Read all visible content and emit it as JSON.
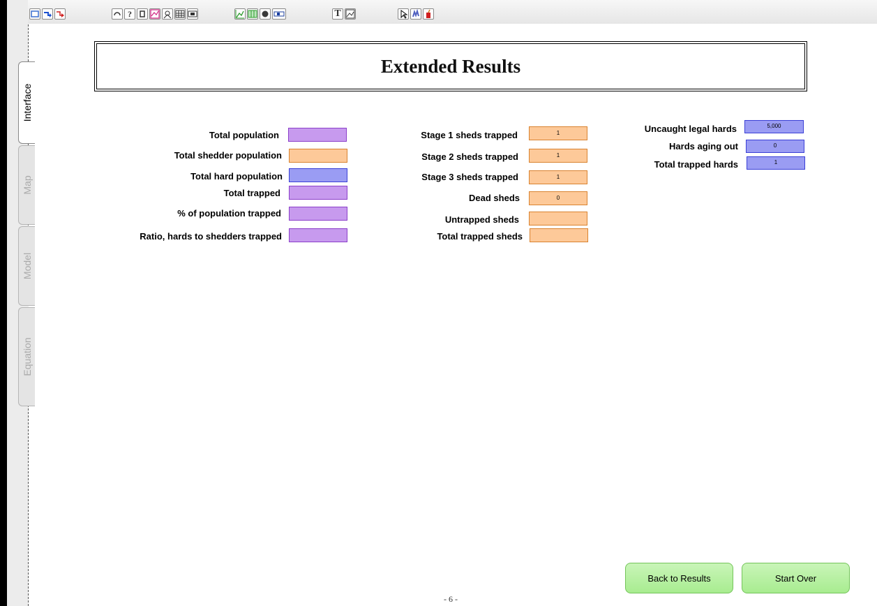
{
  "tabs": [
    {
      "label": "Interface",
      "active": true
    },
    {
      "label": "Map",
      "active": false
    },
    {
      "label": "Model",
      "active": false
    },
    {
      "label": "Equation",
      "active": false
    }
  ],
  "toolbar": {
    "icons": [
      "layer-icon",
      "flow-arrow-icon",
      "connector-arrow-icon",
      "loop-icon",
      "help-icon",
      "button-icon",
      "graph-icon",
      "sector-icon",
      "table-icon",
      "numeric-display-icon",
      "graph-pad-icon",
      "table-pad-icon",
      "knob-icon",
      "slider-icon",
      "text-icon",
      "image-icon",
      "pointer-icon",
      "hand-icon",
      "dynamite-icon"
    ],
    "help_glyph": "?",
    "text_glyph": "T"
  },
  "header": {
    "title": "Extended Results"
  },
  "left_column": {
    "total_population": {
      "label": "Total population",
      "value": ""
    },
    "total_shedder_population": {
      "label": "Total shedder population",
      "value": ""
    },
    "total_hard_population": {
      "label": "Total hard population",
      "value": ""
    },
    "total_trapped": {
      "label": "Total trapped",
      "value": ""
    },
    "percent_trapped": {
      "label": "% of population trapped",
      "value": ""
    },
    "ratio_trapped": {
      "label": "Ratio, hards to shedders trapped",
      "value": ""
    }
  },
  "middle_column": {
    "stage1": {
      "label": "Stage 1 sheds trapped",
      "value": "1"
    },
    "stage2": {
      "label": "Stage 2 sheds trapped",
      "value": "1"
    },
    "stage3": {
      "label": "Stage 3 sheds trapped",
      "value": "1"
    },
    "dead": {
      "label": "Dead sheds",
      "value": "0"
    },
    "untrapped": {
      "label": "Untrapped sheds",
      "value": ""
    },
    "total_trapped_sheds": {
      "label": "Total trapped sheds",
      "value": ""
    }
  },
  "right_column": {
    "uncaught_legal_hards": {
      "label": "Uncaught legal hards",
      "value": "5,000"
    },
    "hards_aging_out": {
      "label": "Hards aging out",
      "value": "0"
    },
    "total_trapped_hards": {
      "label": "Total trapped hards",
      "value": "1"
    }
  },
  "buttons": {
    "back": "Back to Results",
    "start_over": "Start Over"
  },
  "footer": {
    "page_number": "- 6 -"
  },
  "colors": {
    "purple_field": "#c79aee",
    "orange_field": "#fdc999",
    "blue_field": "#9a9cf3",
    "button_green": "#b4ef9f"
  }
}
